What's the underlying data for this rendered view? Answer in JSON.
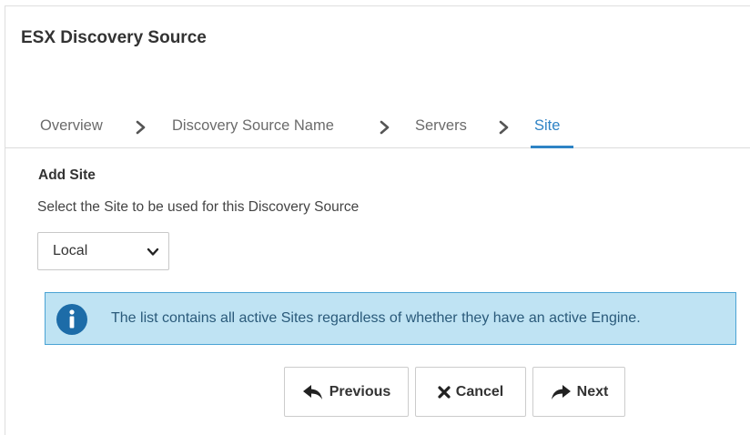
{
  "page": {
    "title": "ESX Discovery Source"
  },
  "wizard": {
    "steps": [
      {
        "label": "Overview",
        "active": false
      },
      {
        "label": "Discovery Source Name",
        "active": false
      },
      {
        "label": "Servers",
        "active": false
      },
      {
        "label": "Site",
        "active": true
      }
    ],
    "separator_icon": "chevron-right-icon",
    "active_color": "#2e83c5"
  },
  "site_section": {
    "heading": "Add Site",
    "description": "Select the Site to be used for this Discovery Source",
    "select": {
      "value": "Local",
      "icon": "chevron-down-icon"
    }
  },
  "info_banner": {
    "icon": "info-icon",
    "text": "The list contains all active Sites regardless of whether they have an active Engine.",
    "background": "#bfe3f3",
    "border": "#4aa3d4",
    "icon_color": "#1d6ca8"
  },
  "buttons": {
    "previous": {
      "label": "Previous",
      "icon": "reply-arrow-icon"
    },
    "cancel": {
      "label": "Cancel",
      "icon": "x-icon"
    },
    "next": {
      "label": "Next",
      "icon": "forward-arrow-icon"
    }
  }
}
